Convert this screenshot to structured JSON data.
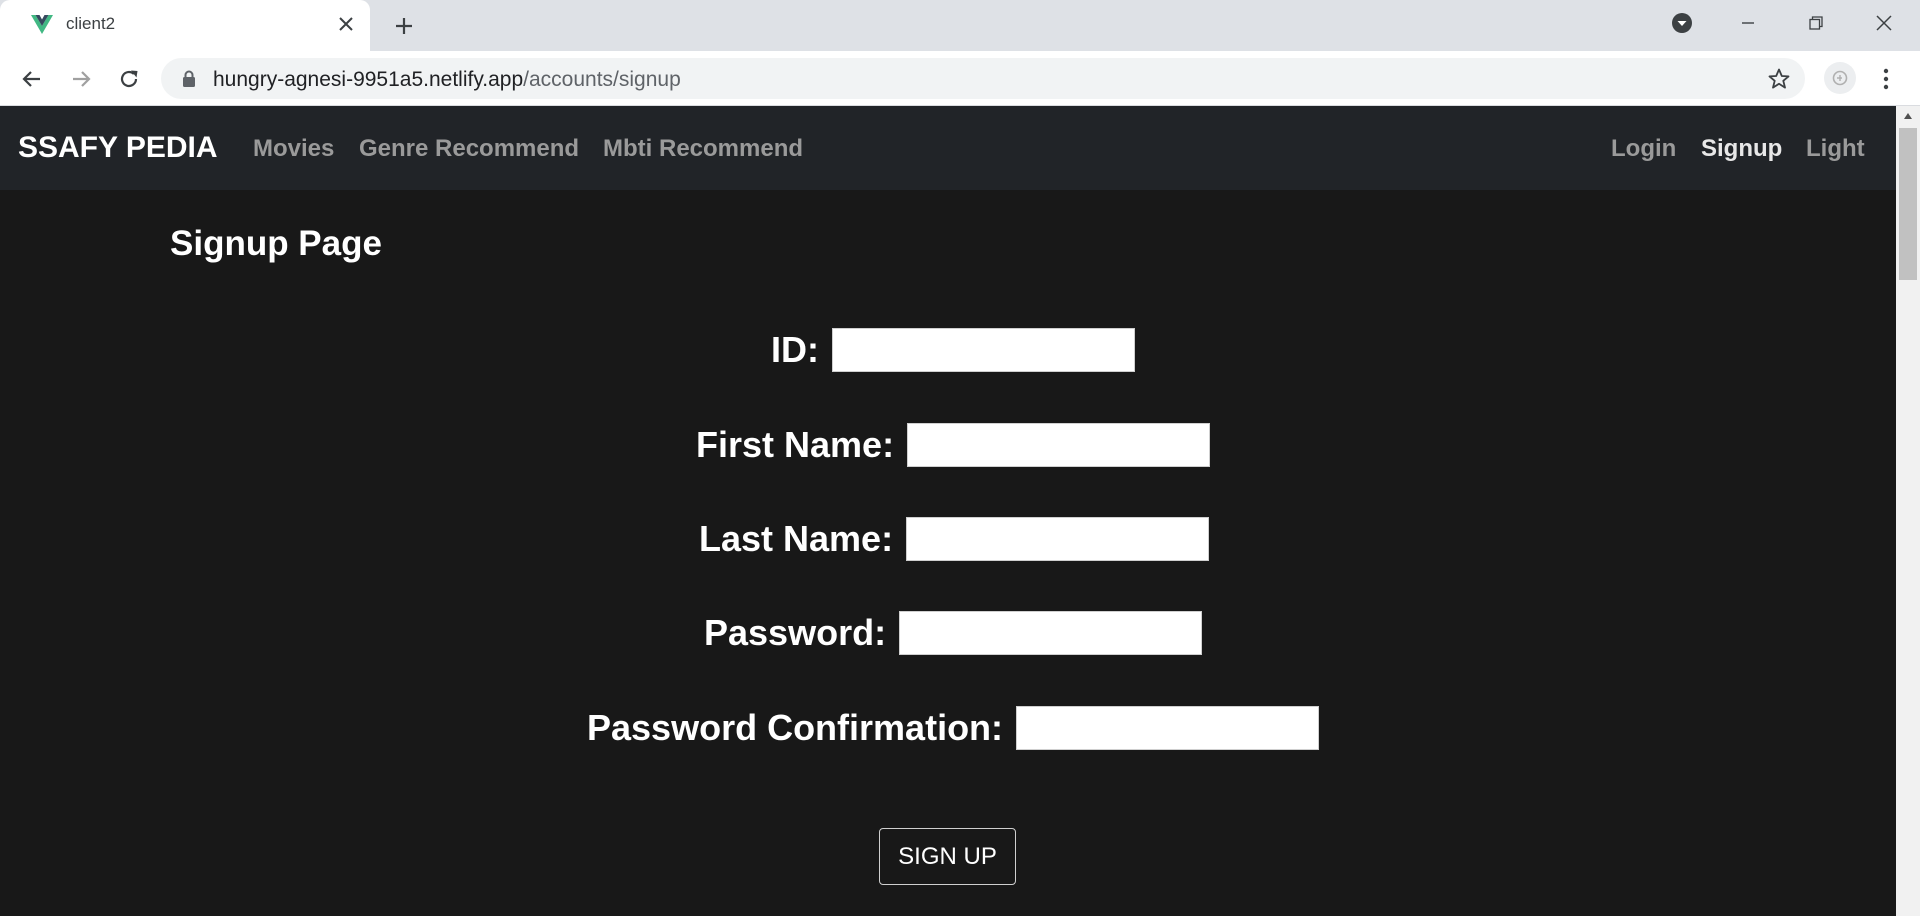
{
  "browser": {
    "tab_title": "client2",
    "url_host": "hungry-agnesi-9951a5.netlify.app",
    "url_path": "/accounts/signup"
  },
  "navbar": {
    "brand": "SSAFY PEDIA",
    "left_links": [
      "Movies",
      "Genre Recommend",
      "Mbti Recommend"
    ],
    "right_links": [
      "Login",
      "Signup",
      "Light"
    ],
    "active_link": "Signup"
  },
  "page": {
    "title": "Signup Page",
    "fields": [
      {
        "label": "ID:",
        "value": ""
      },
      {
        "label": "First Name:",
        "value": ""
      },
      {
        "label": "Last Name:",
        "value": ""
      },
      {
        "label": "Password:",
        "value": ""
      },
      {
        "label": "Password Confirmation:",
        "value": ""
      }
    ],
    "submit_label": "SIGN UP"
  },
  "colors": {
    "navbar_bg": "#212428",
    "page_bg": "#181818",
    "nav_link": "#9a9a9a",
    "vue_green": "#41b883",
    "vue_dark": "#35495e"
  }
}
